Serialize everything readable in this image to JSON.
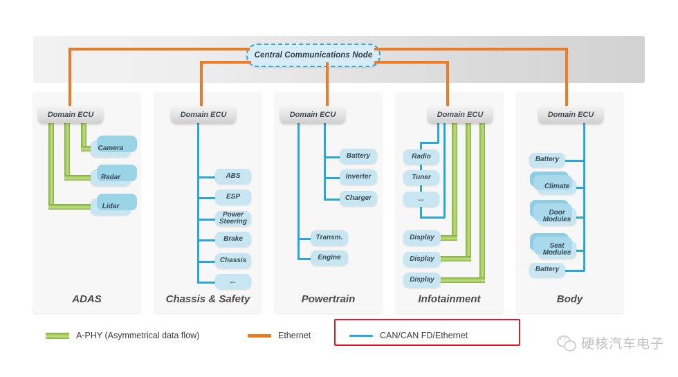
{
  "diagram": {
    "central_node": "Central Communications Node",
    "ecu_label": "Domain ECU",
    "columns": [
      {
        "id": "adas",
        "label": "ADAS",
        "nodes": [
          "Camera",
          "Radar",
          "Lidar"
        ],
        "link_type": "A-PHY"
      },
      {
        "id": "chassis",
        "label": "Chassis & Safety",
        "nodes": [
          "ABS",
          "ESP",
          "Power Steering",
          "Brake",
          "Chassis",
          "..."
        ],
        "link_type": "CAN/CAN FD/Ethernet"
      },
      {
        "id": "powertrain",
        "label": "Powertrain",
        "nodes": [
          "Battery",
          "Inverter",
          "Charger",
          "Transm.",
          "Engine"
        ],
        "link_type": "CAN/CAN FD/Ethernet"
      },
      {
        "id": "infotainment",
        "label": "Infotainment",
        "nodes": [
          "Radio",
          "Tuner",
          "...",
          "Display",
          "Display",
          "Display"
        ],
        "link_type": "CAN/CAN FD/Ethernet + A-PHY"
      },
      {
        "id": "body",
        "label": "Body",
        "nodes": [
          "Battery",
          "Climate",
          "Door Modules",
          "Seat Modules",
          "Battery"
        ],
        "link_type": "CAN/CAN FD/Ethernet"
      }
    ]
  },
  "legend": {
    "items": [
      {
        "label": "A-PHY (Asymmetrical data flow)",
        "color": "#8DBF43",
        "swatch": "green-bar"
      },
      {
        "label": "Ethernet",
        "color": "#EC7C23",
        "swatch": "orange-line"
      },
      {
        "label": "CAN/CAN FD/Ethernet",
        "color": "#29A8D8",
        "swatch": "blue-line"
      }
    ],
    "highlight_color": "#E8171F"
  },
  "watermark": {
    "text": "硬核汽车电子",
    "icon": "wechat-icon"
  }
}
